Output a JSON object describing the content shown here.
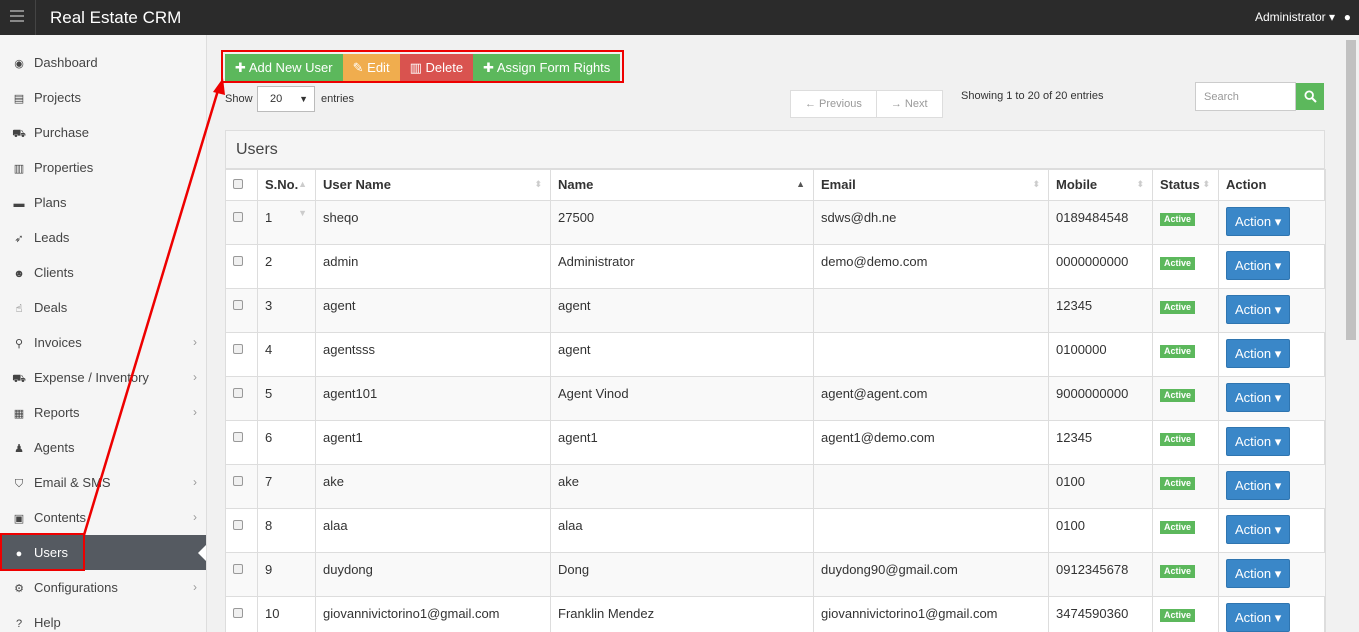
{
  "app": {
    "title": "Real Estate CRM",
    "user": "Administrator"
  },
  "sidebar": {
    "items": [
      {
        "label": "Dashboard",
        "icon": "dashboard-icon",
        "glyph": "◉",
        "chevron": false
      },
      {
        "label": "Projects",
        "icon": "server-icon",
        "glyph": "▤",
        "chevron": false
      },
      {
        "label": "Purchase",
        "icon": "cart-icon",
        "glyph": "⛟",
        "chevron": false
      },
      {
        "label": "Properties",
        "icon": "building-icon",
        "glyph": "▥",
        "chevron": false
      },
      {
        "label": "Plans",
        "icon": "briefcase-icon",
        "glyph": "▬",
        "chevron": false
      },
      {
        "label": "Leads",
        "icon": "rocket-icon",
        "glyph": "➶",
        "chevron": false
      },
      {
        "label": "Clients",
        "icon": "users-icon",
        "glyph": "☻",
        "chevron": false
      },
      {
        "label": "Deals",
        "icon": "thumbs-up-icon",
        "glyph": "☝",
        "chevron": false
      },
      {
        "label": "Invoices",
        "icon": "pin-icon",
        "glyph": "⚲",
        "chevron": true
      },
      {
        "label": "Expense / Inventory",
        "icon": "cart-icon",
        "glyph": "⛟",
        "chevron": true
      },
      {
        "label": "Reports",
        "icon": "table-icon",
        "glyph": "▦",
        "chevron": true
      },
      {
        "label": "Agents",
        "icon": "user-secret-icon",
        "glyph": "♟",
        "chevron": false
      },
      {
        "label": "Email & SMS",
        "icon": "shield-icon",
        "glyph": "⛉",
        "chevron": true
      },
      {
        "label": "Contents",
        "icon": "newspaper-icon",
        "glyph": "▣",
        "chevron": true
      },
      {
        "label": "Users",
        "icon": "user-icon",
        "glyph": "●",
        "chevron": false,
        "active": true
      },
      {
        "label": "Configurations",
        "icon": "cogs-icon",
        "glyph": "⚙",
        "chevron": true
      },
      {
        "label": "Help",
        "icon": "question-icon",
        "glyph": "?",
        "chevron": false
      }
    ]
  },
  "toolbar": {
    "add": "Add New User",
    "edit": "Edit",
    "delete": "Delete",
    "assign": "Assign Form Rights"
  },
  "controls": {
    "show": "Show",
    "entries_value": "20",
    "entries": "entries",
    "prev": "← Previous",
    "next": "→ Next",
    "showing": "Showing 1 to 20 of 20 entries",
    "search_placeholder": "Search"
  },
  "panel": {
    "title": "Users"
  },
  "table": {
    "headers": [
      "S.No.",
      "User Name",
      "Name",
      "Email",
      "Mobile",
      "Status",
      "Action"
    ],
    "rows": [
      {
        "sno": "1",
        "username": "sheqo",
        "name": "27500",
        "email": "sdws@dh.ne",
        "mobile": "0189484548",
        "status": "Active",
        "action": "Action"
      },
      {
        "sno": "2",
        "username": "admin",
        "name": "Administrator",
        "email": "demo@demo.com",
        "mobile": "0000000000",
        "status": "Active",
        "action": "Action"
      },
      {
        "sno": "3",
        "username": "agent",
        "name": "agent",
        "email": "",
        "mobile": "12345",
        "status": "Active",
        "action": "Action"
      },
      {
        "sno": "4",
        "username": "agentsss",
        "name": "agent",
        "email": "",
        "mobile": "0100000",
        "status": "Active",
        "action": "Action"
      },
      {
        "sno": "5",
        "username": "agent101",
        "name": "Agent Vinod",
        "email": "agent@agent.com",
        "mobile": "9000000000",
        "status": "Active",
        "action": "Action"
      },
      {
        "sno": "6",
        "username": "agent1",
        "name": "agent1",
        "email": "agent1@demo.com",
        "mobile": "12345",
        "status": "Active",
        "action": "Action"
      },
      {
        "sno": "7",
        "username": "ake",
        "name": "ake",
        "email": "",
        "mobile": "0100",
        "status": "Active",
        "action": "Action"
      },
      {
        "sno": "8",
        "username": "alaa",
        "name": "alaa",
        "email": "",
        "mobile": "0100",
        "status": "Active",
        "action": "Action"
      },
      {
        "sno": "9",
        "username": "duydong",
        "name": "Dong",
        "email": "duydong90@gmail.com",
        "mobile": "0912345678",
        "status": "Active",
        "action": "Action"
      },
      {
        "sno": "10",
        "username": "giovannivictorino1@gmail.com",
        "name": "Franklin Mendez",
        "email": "giovannivictorino1@gmail.com",
        "mobile": "3474590360",
        "status": "Active",
        "action": "Action"
      }
    ]
  },
  "colors": {
    "accent_green": "#5cb85c",
    "accent_orange": "#f0ad4e",
    "accent_red": "#d9534f",
    "action_blue": "#3a87c8",
    "highlight": "#e00000"
  }
}
